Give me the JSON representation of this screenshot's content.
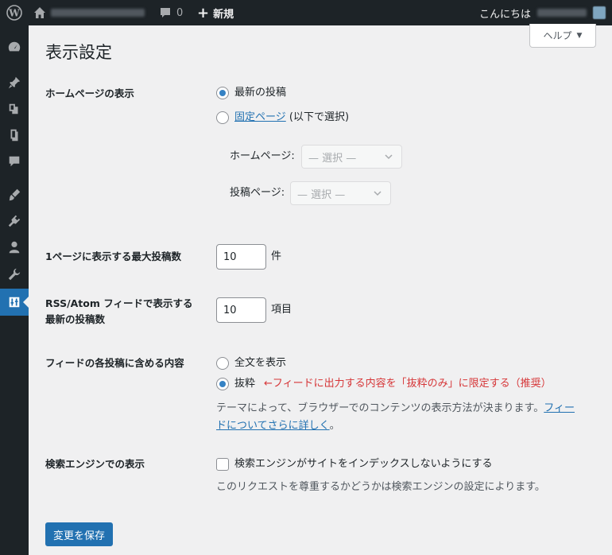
{
  "adminbar": {
    "comment_count": "0",
    "new_label": "新規",
    "greeting": "こんにちは"
  },
  "help": {
    "label": "ヘルプ",
    "caret": "▼"
  },
  "page_title": "表示設定",
  "homepage": {
    "heading": "ホームページの表示",
    "option_latest": "最新の投稿",
    "option_static_link": "固定ページ",
    "option_static_suffix": " (以下で選択)",
    "homepage_label": "ホームページ:",
    "homepage_select": "— 選択 —",
    "posts_label": "投稿ページ:",
    "posts_select": "— 選択 —"
  },
  "posts_per_page": {
    "heading": "1ページに表示する最大投稿数",
    "value": "10",
    "unit": "件"
  },
  "rss": {
    "heading_line1": "RSS/Atom フィードで表示する",
    "heading_line2": "最新の投稿数",
    "value": "10",
    "unit": "項目"
  },
  "feed_content": {
    "heading": "フィードの各投稿に含める内容",
    "option_full": "全文を表示",
    "option_excerpt": "抜粋",
    "annotation": "←フィードに出力する内容を「抜粋のみ」に限定する（推奨）",
    "desc_text": "テーマによって、ブラウザーでのコンテンツの表示方法が決まります。",
    "desc_link_part1": "フィー",
    "desc_link_part2": "ドについてさらに詳しく",
    "desc_end": "。"
  },
  "search_engine": {
    "heading": "検索エンジンでの表示",
    "checkbox_label": "検索エンジンがサイトをインデックスしないようにする",
    "desc": "このリクエストを尊重するかどうかは検索エンジンの設定によります。"
  },
  "save_button": "変更を保存",
  "colors": {
    "adminbar_bg": "#1d2327",
    "accent": "#2271b1",
    "annotation": "#d63638"
  }
}
